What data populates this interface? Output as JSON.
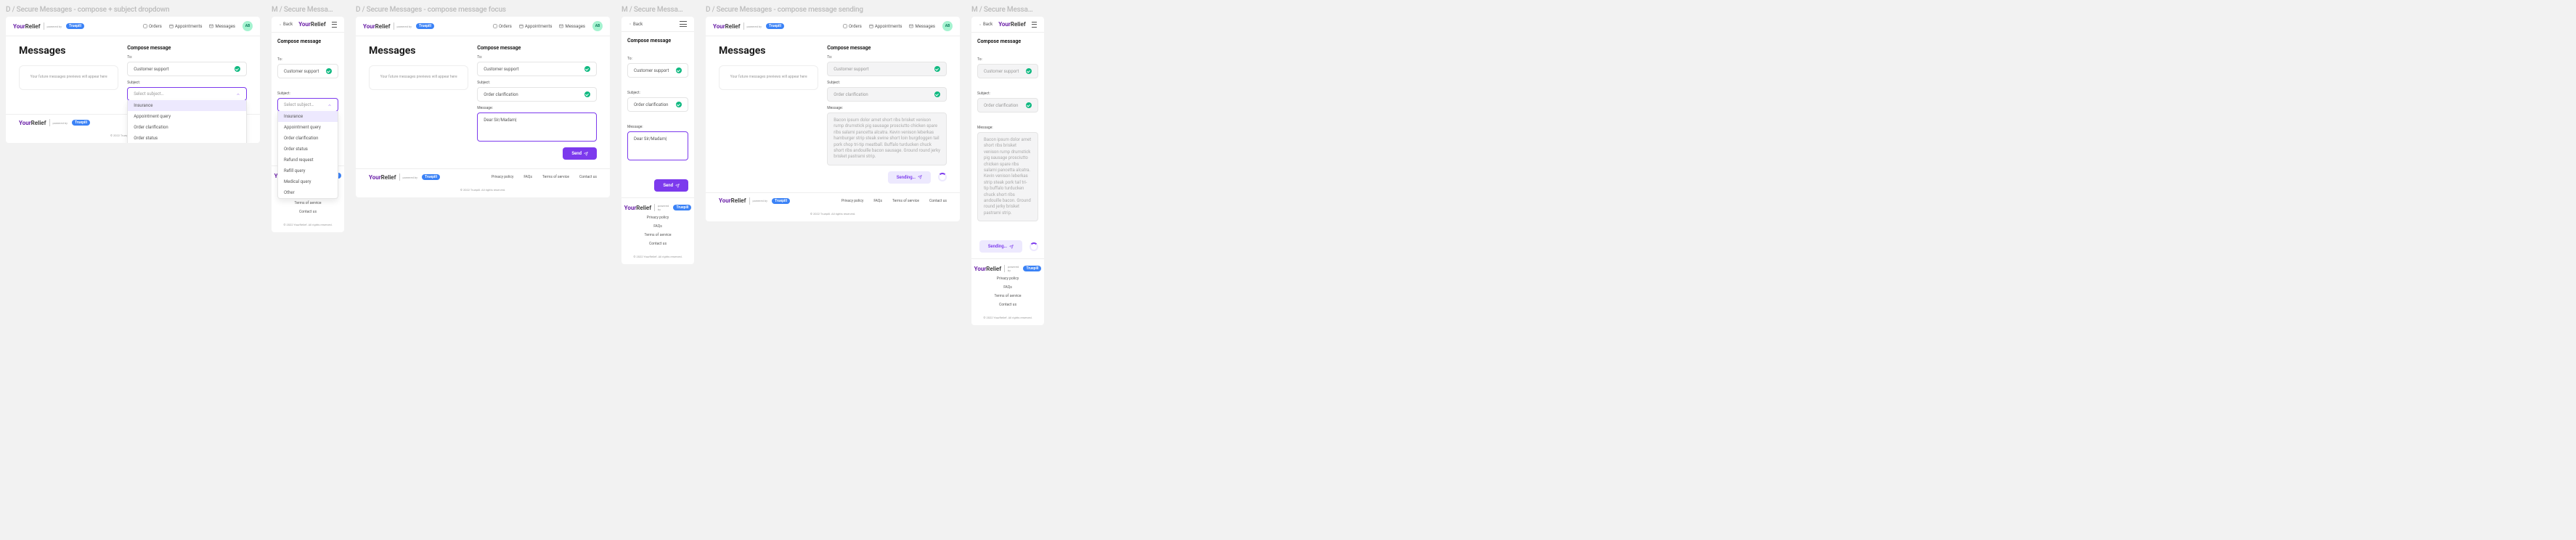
{
  "frames": {
    "d1_label": "D / Secure Messages - compose + subject dropdown",
    "m1_label": "M / Secure Messa…",
    "d2_label": "D / Secure Messages - compose message focus",
    "m2_label": "M / Secure Messa…",
    "d3_label": "D / Secure Messages - compose message sending",
    "m3_label": "M / Secure Messa…"
  },
  "brand": {
    "your": "Your",
    "relief": "Relief",
    "powered_by": "powered by",
    "truepill": "Truepill"
  },
  "nav": {
    "orders": "Orders",
    "appointments": "Appointments",
    "messages": "Messages",
    "avatar": "AB",
    "back": "Back"
  },
  "page": {
    "title": "Messages",
    "preview_placeholder": "Your future messages previews will appear here"
  },
  "compose": {
    "title": "Compose message",
    "to_label": "To:",
    "to_value": "Customer support",
    "subject_label": "Subject:",
    "subject_placeholder": "Select subject…",
    "subject_value": "Order clarification",
    "message_label": "Message:",
    "message_placeholder": "Dear Sir/Madam|",
    "message_lorem": "Bacon ipsum dolor amet short ribs brisket venison rump drumstick pig sausage prosciutto chicken spare ribs salami pancetta alcatra. Kevin venison leberkas hamburger strip steak swine short loin burgdoggen tail pork chop tri-tip meatball. Buffalo turducken chuck short ribs andouille bacon sausage. Ground round jerky brisket pastrami strip.",
    "message_lorem_m": "Bacon ipsum dolor amet short ribs brisket venison rump drumstick pig sausage prosciutto chicken spare ribs salami pancetta alcatra. Kevin venison leberkas strip steak pork tail tri-tip buffalo turducken chuck short ribs andouille bacon. Ground round jerky brisket pastrami strip."
  },
  "subject_options": [
    "Insurance",
    "Appointment query",
    "Order clarification",
    "Order status",
    "Refund request",
    "Refill query",
    "Medical query",
    "Other"
  ],
  "buttons": {
    "send": "Send",
    "sending": "Sending…"
  },
  "footer": {
    "privacy": "Privacy policy",
    "faqs": "FAQs",
    "terms": "Terms of service",
    "contact": "Contact us",
    "copyright_d": "© 2022 Truepill. All rights reserved.",
    "copyright_m": "© 2022 YourRelief. All rights reserved."
  }
}
